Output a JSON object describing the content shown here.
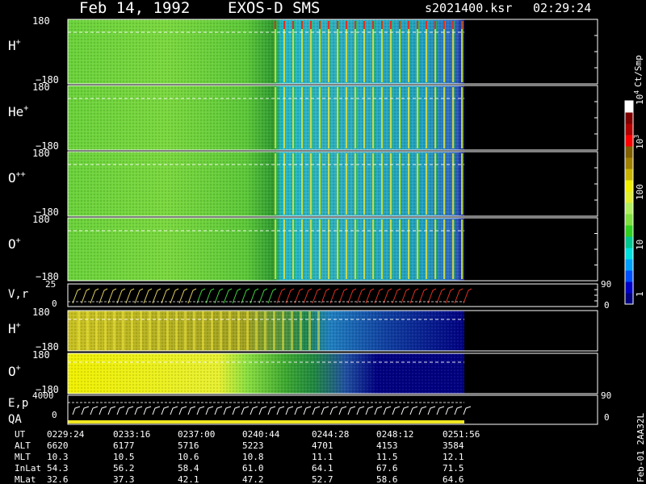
{
  "header": {
    "date": "Feb 14, 1992",
    "instrument": "EXOS-D SMS",
    "file": "s2021400.ksr",
    "time": "02:29:24"
  },
  "colorbar": {
    "label": "Ct/Smp",
    "ticks": [
      "1",
      "10",
      "100",
      "10",
      "10"
    ],
    "tick_exponents": [
      "",
      "",
      "",
      "3",
      "4"
    ],
    "colors": [
      "#000080",
      "#0000c8",
      "#0050ff",
      "#00a0ff",
      "#00e0e0",
      "#00c890",
      "#30d020",
      "#80e040",
      "#b0f060",
      "#e0f030",
      "#f0f000",
      "#c8b400",
      "#a08000",
      "#806000",
      "#ff0000",
      "#b00000",
      "#800000",
      "#ffffff"
    ]
  },
  "panels": [
    {
      "label": "H",
      "sup": "+",
      "ytop": "180",
      "ybot": "−180"
    },
    {
      "label": "He",
      "sup": "+",
      "ytop": "180",
      "ybot": "−180"
    },
    {
      "label": "O",
      "sup": "++",
      "ytop": "180",
      "ybot": "−180"
    },
    {
      "label": "O",
      "sup": "+",
      "ytop": "180",
      "ybot": "−180"
    }
  ],
  "vr_panel": {
    "label": "V,r",
    "ytop": "25",
    "ybot": "0",
    "rtop": "90",
    "rbot": "0"
  },
  "lower_panels": [
    {
      "label": "H",
      "sup": "+",
      "ytop": "180",
      "ybot": "−180"
    },
    {
      "label": "O",
      "sup": "+",
      "ytop": "180",
      "ybot": "−180"
    }
  ],
  "ep_panel": {
    "label1": "E,p",
    "label2": "QA",
    "ytop": "4000",
    "ybot": "0",
    "rtop": "90",
    "rbot": "0"
  },
  "footer_id": "Feb-01  2AA32L",
  "ephemeris": {
    "rows": [
      {
        "name": "UT",
        "values": [
          "0229:24",
          "0233:16",
          "0237:00",
          "0240:44",
          "0244:28",
          "0248:12",
          "0251:56"
        ]
      },
      {
        "name": "ALT",
        "values": [
          "6620",
          "6177",
          "5716",
          "5223",
          "4701",
          "4153",
          "3584"
        ]
      },
      {
        "name": "MLT",
        "values": [
          "10.3",
          "10.5",
          "10.6",
          "10.8",
          "11.1",
          "11.5",
          "12.1"
        ]
      },
      {
        "name": "InLat",
        "values": [
          "54.3",
          "56.2",
          "58.4",
          "61.0",
          "64.1",
          "67.6",
          "71.5"
        ]
      },
      {
        "name": "MLat",
        "values": [
          "32.6",
          "37.3",
          "42.1",
          "47.2",
          "52.7",
          "58.6",
          "64.6"
        ]
      }
    ]
  }
}
